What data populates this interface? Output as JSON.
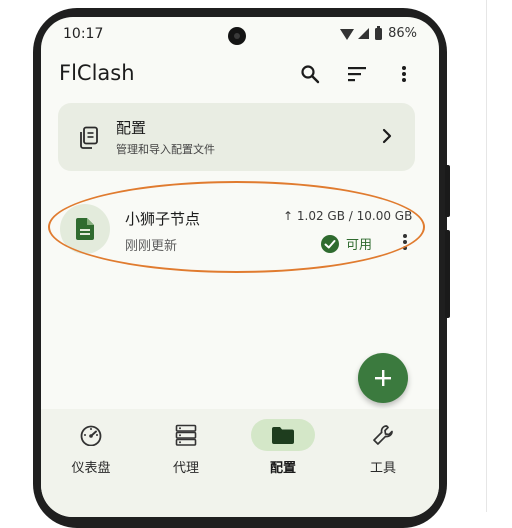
{
  "status_bar": {
    "time": "10:17",
    "battery": "86%"
  },
  "app": {
    "title": "FlClash"
  },
  "icons": {
    "search": "search-icon",
    "sort": "sort-icon",
    "more": "more-vert-icon",
    "config": "copy-file-icon",
    "chevron": "chevron-right-icon",
    "profile": "document-icon",
    "status": "check-circle-icon",
    "add": "plus-icon",
    "dashboard": "speedometer-icon",
    "proxy": "server-icon",
    "config_nav": "folder-icon",
    "tools": "wrench-icon"
  },
  "colors": {
    "accent": "#3b7a3e",
    "highlight": "#e07b2f",
    "card_bg": "#e9ede3",
    "nav_active": "#d4e7c8"
  },
  "config_card": {
    "title": "配置",
    "subtitle": "管理和导入配置文件"
  },
  "profile": {
    "name": "小狮子节点",
    "updated": "刚刚更新",
    "usage": "↑ 1.02 GB / 10.00 GB",
    "status": "可用"
  },
  "bottom_nav": {
    "items": [
      {
        "label": "仪表盘",
        "active": false
      },
      {
        "label": "代理",
        "active": false
      },
      {
        "label": "配置",
        "active": true
      },
      {
        "label": "工具",
        "active": false
      }
    ]
  }
}
